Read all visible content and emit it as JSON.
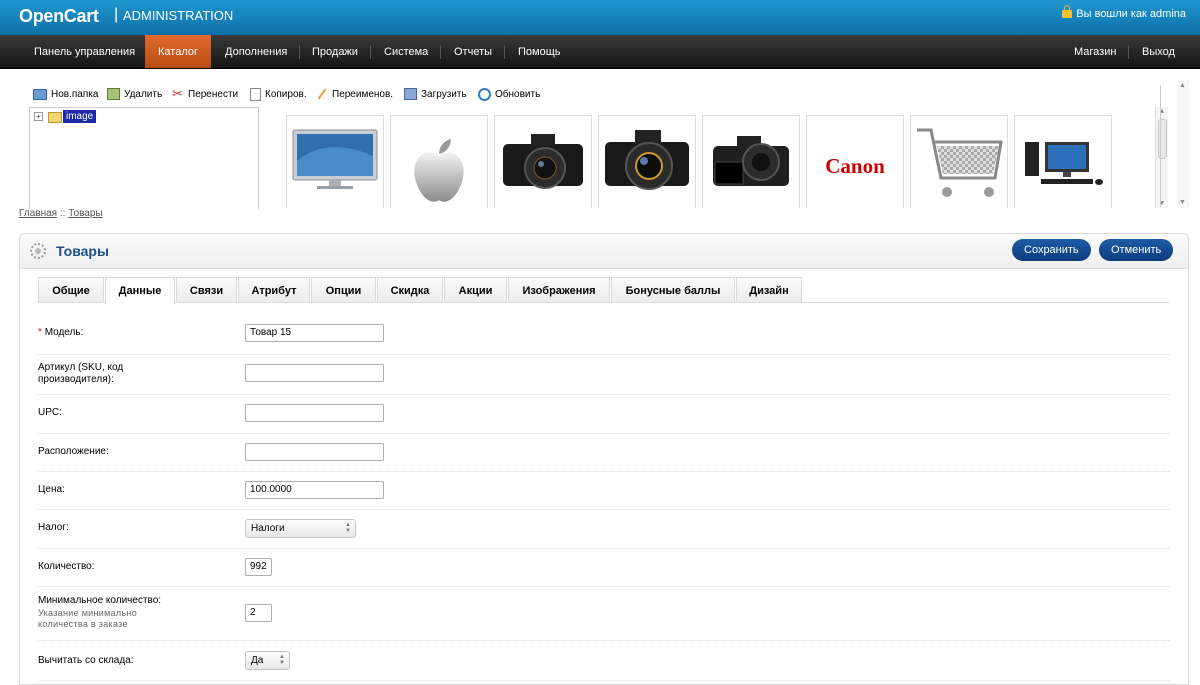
{
  "header": {
    "logo": "OpenCart",
    "separator": "|",
    "subtitle": "ADMINISTRATION",
    "login_text": "Вы вошли как admina"
  },
  "menu": {
    "items": [
      "Панель управления",
      "Каталог",
      "Дополнения",
      "Продажи",
      "Система",
      "Отчеты",
      "Помощь"
    ],
    "active": "Каталог",
    "right_items": [
      "Магазин",
      "Выход"
    ]
  },
  "filemanager": {
    "toolbar": [
      "Нов.папка",
      "Удалить",
      "Перенести",
      "Копиров.",
      "Переименов.",
      "Загрузить",
      "Обновить"
    ],
    "tree_root": "image",
    "thumbs": [
      "monitor",
      "apple-logo",
      "canon-camera-1",
      "canon-camera-2",
      "canon-camera-3",
      "canon-logo",
      "shopping-cart",
      "desktop-pc"
    ],
    "canon_text": "Canon"
  },
  "breadcrumb": {
    "items": [
      "Главная",
      "Товары"
    ],
    "separator": "::"
  },
  "page": {
    "title": "Товары",
    "save_label": "Сохранить",
    "cancel_label": "Отменить"
  },
  "tabs": [
    "Общие",
    "Данные",
    "Связи",
    "Атрибут",
    "Опции",
    "Скидка",
    "Акции",
    "Изображения",
    "Бонусные баллы",
    "Дизайн"
  ],
  "active_tab": "Данные",
  "form": {
    "model": {
      "required": "*",
      "label": "Модель:",
      "value": "Товар 15"
    },
    "sku": {
      "label": "Артикул (SKU, код производителя):",
      "value": ""
    },
    "upc": {
      "label": "UPC:",
      "value": ""
    },
    "location": {
      "label": "Расположение:",
      "value": ""
    },
    "price": {
      "label": "Цена:",
      "value": "100.0000"
    },
    "tax": {
      "label": "Налог:",
      "value": "Налоги"
    },
    "quantity": {
      "label": "Количество:",
      "value": "992"
    },
    "minimum": {
      "label": "Минимальное количество:",
      "help": "Указание минимально количества в заказе",
      "value": "2"
    },
    "subtract": {
      "label": "Вычитать со склада:",
      "value": "Да"
    }
  },
  "colors": {
    "header": "#1683be",
    "menu": "#222222",
    "active_menu": "#d35d1f",
    "title": "#1c4f89",
    "button": "#164c95"
  }
}
